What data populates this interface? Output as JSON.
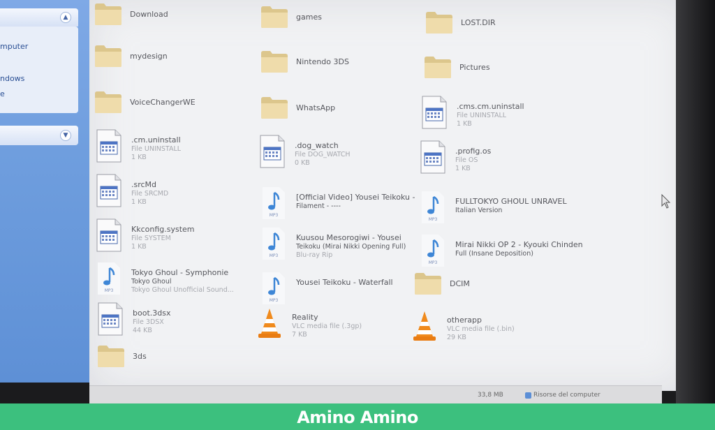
{
  "task_pane": {
    "links": [
      "mputer",
      "ndows",
      "e"
    ]
  },
  "items": [
    {
      "type": "folder",
      "name": "Download"
    },
    {
      "type": "folder",
      "name": "games"
    },
    {
      "type": "folder",
      "name": "LOST.DIR"
    },
    {
      "type": "folder",
      "name": "mydesign"
    },
    {
      "type": "folder",
      "name": "Nintendo 3DS"
    },
    {
      "type": "folder",
      "name": "Pictures"
    },
    {
      "type": "folder",
      "name": "VoiceChangerWE"
    },
    {
      "type": "folder",
      "name": "WhatsApp"
    },
    {
      "type": "file",
      "name": ".cms.cm.uninstall",
      "kind": "File UNINSTALL",
      "size": "1 KB"
    },
    {
      "type": "file",
      "name": ".cm.uninstall",
      "kind": "File UNINSTALL",
      "size": "1 KB"
    },
    {
      "type": "file",
      "name": ".dog_watch",
      "kind": "File DOG_WATCH",
      "size": "0 KB"
    },
    {
      "type": "file",
      "name": ".profig.os",
      "kind": "File OS",
      "size": "1 KB"
    },
    {
      "type": "file",
      "name": ".srcMd",
      "kind": "File SRCMD",
      "size": "1 KB"
    },
    {
      "type": "audio",
      "name": "[Official Video] Yousei Teikoku -",
      "name2": "Filament - ----"
    },
    {
      "type": "audio",
      "name": "FULLTOKYO GHOUL UNRAVEL",
      "name2": "Italian Version"
    },
    {
      "type": "file",
      "name": "Kkconfig.system",
      "kind": "File SYSTEM",
      "size": "1 KB"
    },
    {
      "type": "audio",
      "name": "Kuusou Mesorogiwi - Yousei",
      "name2": "Teikoku (Mirai Nikki Opening Full)",
      "extra": "Blu-ray Rip"
    },
    {
      "type": "audio",
      "name": "Mirai Nikki OP 2 - Kyouki Chinden",
      "name2": "Full (Insane Deposition)"
    },
    {
      "type": "audio",
      "name": "Tokyo Ghoul - Symphonie",
      "name2": "Tokyo Ghoul",
      "extra": "Tokyo Ghoul Unofficial Sound..."
    },
    {
      "type": "audio",
      "name": "Yousei Teikoku - Waterfall"
    },
    {
      "type": "folder",
      "name": "DCIM"
    },
    {
      "type": "file",
      "name": "boot.3dsx",
      "kind": "File 3DSX",
      "size": "44 KB"
    },
    {
      "type": "vlc",
      "name": "Reality",
      "kind": "VLC media file (.3gp)",
      "size": "7 KB"
    },
    {
      "type": "vlc",
      "name": "otherapp",
      "kind": "VLC media file (.bin)",
      "size": "29 KB"
    },
    {
      "type": "folder",
      "name": "3ds"
    }
  ],
  "status_bar": {
    "size": "33,8 MB",
    "zone": "Risorse del computer"
  },
  "banner": {
    "text": "Amino Amino"
  },
  "colors": {
    "task_pane": "#6f9ede",
    "banner": "#3cc07e",
    "folder": "#ecd9a2"
  }
}
